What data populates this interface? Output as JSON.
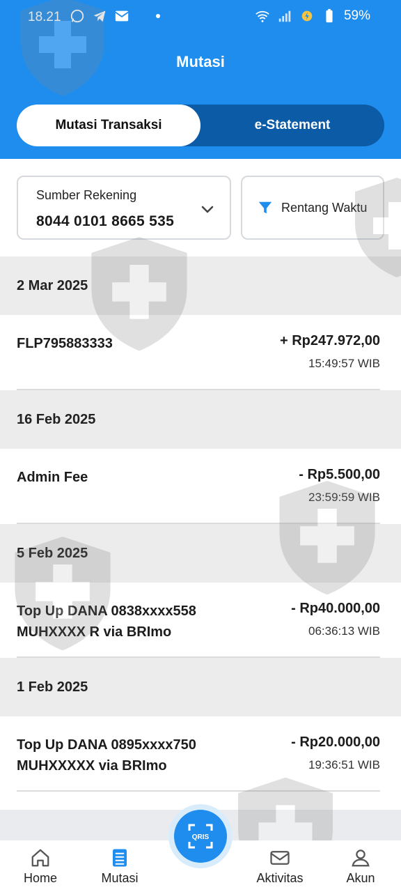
{
  "status_bar": {
    "time": "18.21",
    "battery": "59%"
  },
  "header": {
    "title": "Mutasi"
  },
  "tabs": [
    {
      "label": "Mutasi Transaksi",
      "active": true
    },
    {
      "label": "e-Statement",
      "active": false
    }
  ],
  "filter": {
    "source_label": "Sumber Rekening",
    "source_value": "8044 0101 8665 535",
    "range_label": "Rentang Waktu"
  },
  "groups": [
    {
      "date": "2 Mar 2025",
      "transactions": [
        {
          "description": "FLP795883333",
          "amount": "+ Rp247.972,00",
          "time": "15:49:57 WIB"
        }
      ]
    },
    {
      "date": "16 Feb 2025",
      "transactions": [
        {
          "description": "Admin Fee",
          "amount": "- Rp5.500,00",
          "time": "23:59:59 WIB"
        }
      ]
    },
    {
      "date": "5 Feb 2025",
      "transactions": [
        {
          "description": "Top Up DANA 0838xxxx558\nMUHXXXX R via BRImo",
          "amount": "- Rp40.000,00",
          "time": "06:36:13 WIB"
        }
      ]
    },
    {
      "date": "1 Feb 2025",
      "transactions": [
        {
          "description": "Top Up DANA 0895xxxx750\nMUHXXXXX via BRImo",
          "amount": "- Rp20.000,00",
          "time": "19:36:51 WIB"
        }
      ]
    }
  ],
  "bottom_nav": {
    "home": "Home",
    "mutasi": "Mutasi",
    "qris": "QRIS",
    "aktivitas": "Aktivitas",
    "akun": "Akun"
  },
  "colors": {
    "primary": "#1e8ded",
    "primary_dark": "#0c5ba6",
    "date_header_bg": "#ececec"
  }
}
